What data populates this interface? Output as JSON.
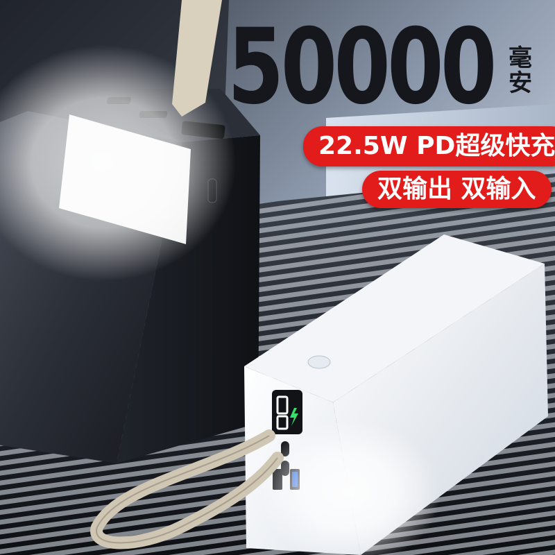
{
  "headline": {
    "capacity": "50000",
    "unit_line_1": "毫",
    "unit_line_2": "安"
  },
  "badges": {
    "fast_charge": "22.5W PD超级快充",
    "dual_io": "双输出 双输入"
  },
  "colors": {
    "badge_red": "#e21b1b",
    "headline_text": "#15171c",
    "black_powerbank": "#1c1f26",
    "white_powerbank": "#eef1f5",
    "led_display_green": "#37e06a",
    "lanyard": "#cfc6b4"
  },
  "icons": {
    "led_display": "digital-display-icon",
    "lightning": "lightning-icon",
    "power_button": "power-button-icon"
  }
}
